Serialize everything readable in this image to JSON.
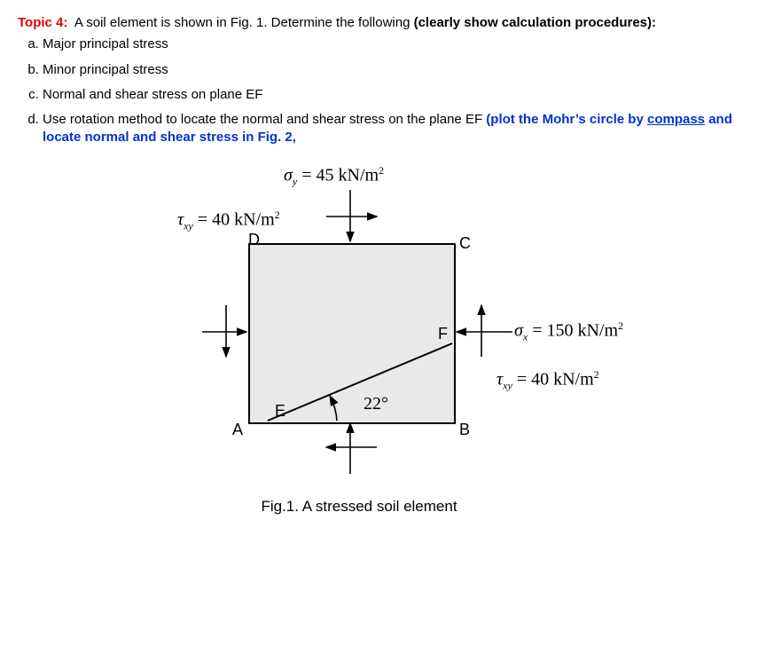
{
  "header": {
    "topic_label": "Topic 4:",
    "topic_text": " A soil element is shown in Fig. 1. Determine the following ",
    "topic_bold_tail": "(clearly show calculation procedures):"
  },
  "items": {
    "a": "Major principal stress",
    "b": "Minor principal stress",
    "c": "Normal and shear stress on plane EF",
    "d_lead": "Use rotation method to locate the normal and shear stress on the plane EF ",
    "d_blue1": "(plot the Mohr’s circle by ",
    "d_blue_u": "compass",
    "d_blue2": " and locate normal and shear stress in Fig. 2,"
  },
  "stresses": {
    "sigma_y": {
      "sym": "σ",
      "sub": "y",
      "val": "45",
      "unit": "kN/m",
      "exp": "2"
    },
    "sigma_x": {
      "sym": "σ",
      "sub": "x",
      "val": "150",
      "unit": "kN/m",
      "exp": "2"
    },
    "tau_top": {
      "sym": "τ",
      "sub": "xy",
      "val": "40",
      "unit": "kN/m",
      "exp": "2"
    },
    "tau_right": {
      "sym": "τ",
      "sub": "xy",
      "val": "40",
      "unit": "kN/m",
      "exp": "2"
    }
  },
  "angle": "22°",
  "labels": {
    "A": "A",
    "B": "B",
    "C": "C",
    "D": "D",
    "E": "E",
    "F": "F"
  },
  "caption": "Fig.1. A stressed soil element",
  "chart_data": {
    "type": "diagram",
    "description": "Plane-stress soil element with inclined plane EF",
    "sigma_x_kNm2": 150,
    "sigma_y_kNm2": 45,
    "tau_xy_kNm2": 40,
    "plane_EF_angle_deg_from_horizontal": 22,
    "corners": [
      "A (bottom-left)",
      "B (bottom-right)",
      "C (top-right)",
      "D (top-left)"
    ],
    "plane_points": [
      "E on AB near A",
      "F on BC (right side)"
    ]
  }
}
